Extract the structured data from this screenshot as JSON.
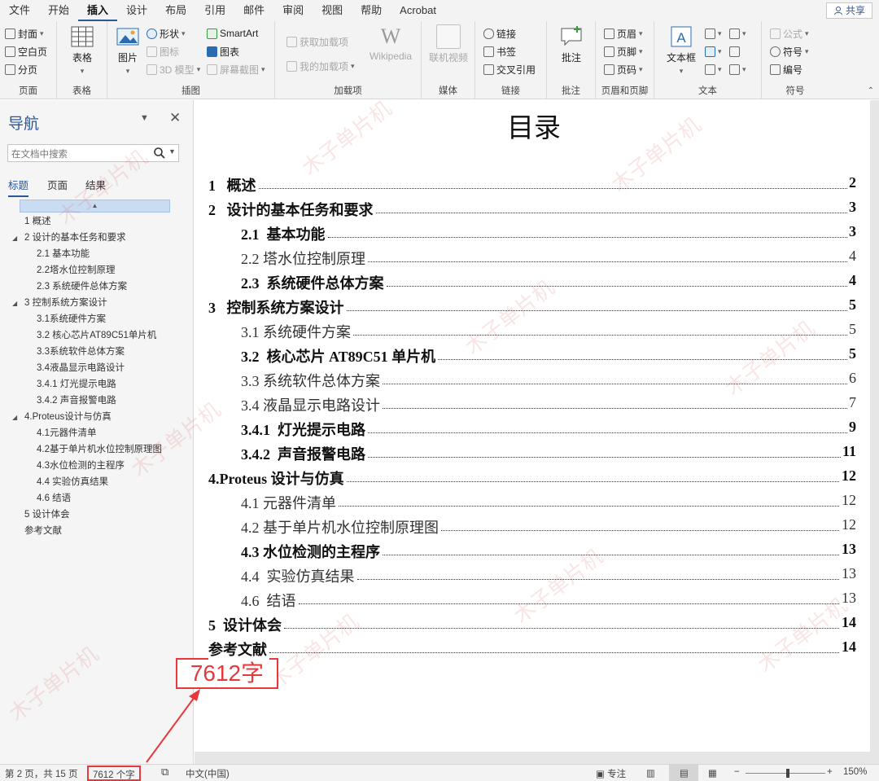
{
  "menu": {
    "tabs": [
      "文件",
      "开始",
      "插入",
      "设计",
      "布局",
      "引用",
      "邮件",
      "审阅",
      "视图",
      "帮助",
      "Acrobat"
    ],
    "active_tab": "插入",
    "share_label": "共享"
  },
  "ribbon": {
    "pages": {
      "cover": "封面",
      "blank": "空白页",
      "break": "分页",
      "label": "页面"
    },
    "tables": {
      "table": "表格",
      "label": "表格"
    },
    "illustrations": {
      "picture": "图片",
      "shapes": "形状",
      "icons": "图标",
      "model3d": "3D 模型",
      "smartart": "SmartArt",
      "chart": "图表",
      "screenshot": "屏幕截图",
      "label": "插图"
    },
    "addins": {
      "get": "获取加载项",
      "my": "我的加载项",
      "wikipedia": "Wikipedia",
      "label": "加载项"
    },
    "media": {
      "video": "联机视频",
      "label": "媒体"
    },
    "links": {
      "link": "链接",
      "bookmark": "书签",
      "crossref": "交叉引用",
      "label": "链接"
    },
    "comments": {
      "comment": "批注",
      "label": "批注"
    },
    "header_footer": {
      "header": "页眉",
      "footer": "页脚",
      "page_number": "页码",
      "label": "页眉和页脚"
    },
    "text": {
      "textbox": "文本框",
      "label": "文本"
    },
    "symbols": {
      "equation": "公式",
      "symbol": "符号",
      "number": "编号",
      "label": "符号"
    }
  },
  "nav": {
    "title": "导航",
    "search_placeholder": "在文档中搜索",
    "tabs": [
      "标题",
      "页面",
      "结果"
    ],
    "headings": [
      "1 概述",
      "2 设计的基本任务和要求",
      "2.1 基本功能",
      "2.2塔水位控制原理",
      "2.3 系统硬件总体方案",
      "3 控制系统方案设计",
      "3.1系统硬件方案",
      "3.2 核心芯片AT89C51单片机",
      "3.3系统软件总体方案",
      "3.4液晶显示电路设计",
      "3.4.1 灯光提示电路",
      "3.4.2 声音报警电路",
      "4.Proteus设计与仿真",
      "4.1元器件清单",
      "4.2基于单片机水位控制原理图",
      "4.3水位检测的主程序",
      "4.4 实验仿真结果",
      "4.6 结语",
      "5 设计体会",
      "参考文献"
    ]
  },
  "document": {
    "title": "目录",
    "toc": [
      {
        "text": "1   概述",
        "page": "2"
      },
      {
        "text": "2   设计的基本任务和要求",
        "page": "3"
      },
      {
        "text": "2.1  基本功能",
        "page": "3"
      },
      {
        "text": "2.2 塔水位控制原理",
        "page": "4"
      },
      {
        "text": "2.3  系统硬件总体方案",
        "page": "4"
      },
      {
        "text": "3   控制系统方案设计",
        "page": "5"
      },
      {
        "text": "3.1 系统硬件方案",
        "page": "5"
      },
      {
        "text": "3.2  核心芯片 AT89C51 单片机",
        "page": "5"
      },
      {
        "text": "3.3 系统软件总体方案",
        "page": "6"
      },
      {
        "text": "3.4 液晶显示电路设计",
        "page": "7"
      },
      {
        "text": "3.4.1  灯光提示电路",
        "page": "9"
      },
      {
        "text": "3.4.2  声音报警电路",
        "page": "11"
      },
      {
        "text": "4.Proteus 设计与仿真",
        "page": "12"
      },
      {
        "text": "4.1 元器件清单",
        "page": "12"
      },
      {
        "text": "4.2 基于单片机水位控制原理图",
        "page": "12"
      },
      {
        "text": "4.3 水位检测的主程序",
        "page": "13"
      },
      {
        "text": "4.4  实验仿真结果",
        "page": "13"
      },
      {
        "text": "4.6  结语",
        "page": "13"
      },
      {
        "text": "5  设计体会",
        "page": "14"
      },
      {
        "text": "参考文献",
        "page": "14"
      }
    ]
  },
  "annotation": {
    "callout": "7612字"
  },
  "watermark": "木子单片机",
  "status": {
    "page_info": "第 2 页，共 15 页",
    "word_count": "7612 个字",
    "language": "中文(中国)",
    "focus": "专注",
    "zoom": "150%",
    "zoom_minus": "−",
    "zoom_plus": "+"
  },
  "colors": {
    "accent": "#2b579a",
    "annotation": "#e8383c"
  }
}
